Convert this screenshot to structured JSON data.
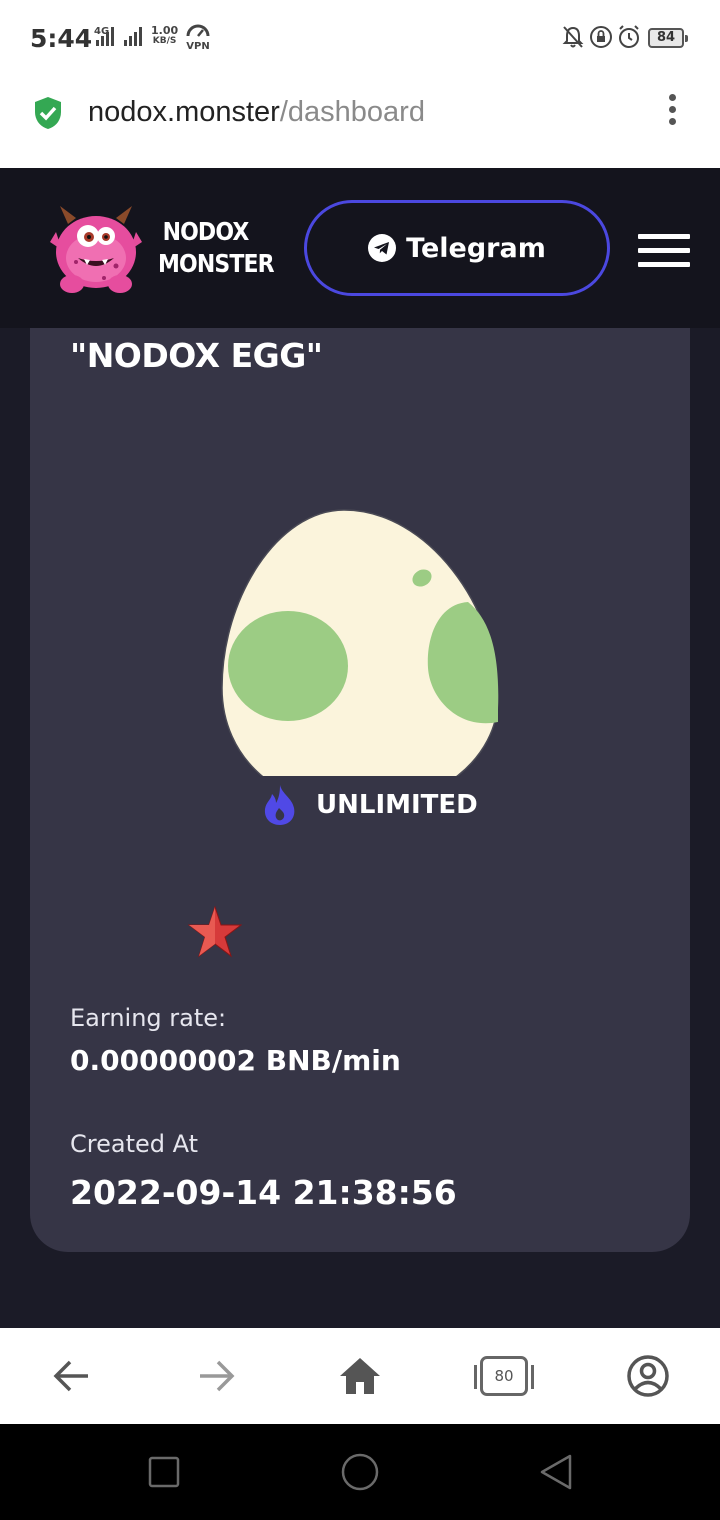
{
  "status_bar": {
    "time": "5:44",
    "network_type": "4G",
    "speed_value": "1.00",
    "speed_unit": "KB/S",
    "vpn": "VPN",
    "battery": "84"
  },
  "browser": {
    "url_host": "nodox.monster",
    "url_path": "/dashboard",
    "tab_count": "80"
  },
  "site": {
    "brand_line1": "NODOX",
    "brand_line2": "MONSTER",
    "telegram_label": "Telegram"
  },
  "card": {
    "title": "\"NODOX EGG\"",
    "tier": "UNLIMITED",
    "earning_label": "Earning rate:",
    "earning_value": "0.00000002 BNB/min",
    "created_label": "Created At",
    "created_value": "2022-09-14 21:38:56"
  },
  "colors": {
    "accent": "#4b48e0",
    "card_bg": "#363546",
    "header_bg": "#14141d",
    "egg_shell": "#fbf4dc",
    "egg_spot": "#9ccc84"
  },
  "icons": [
    "shield-check-icon",
    "kebab-menu-icon",
    "telegram-icon",
    "hamburger-icon",
    "flame-icon",
    "star-icon",
    "back-arrow-icon",
    "forward-arrow-icon",
    "home-icon",
    "tabs-icon",
    "account-icon",
    "recents-icon",
    "home-circle-icon",
    "back-triangle-icon"
  ]
}
